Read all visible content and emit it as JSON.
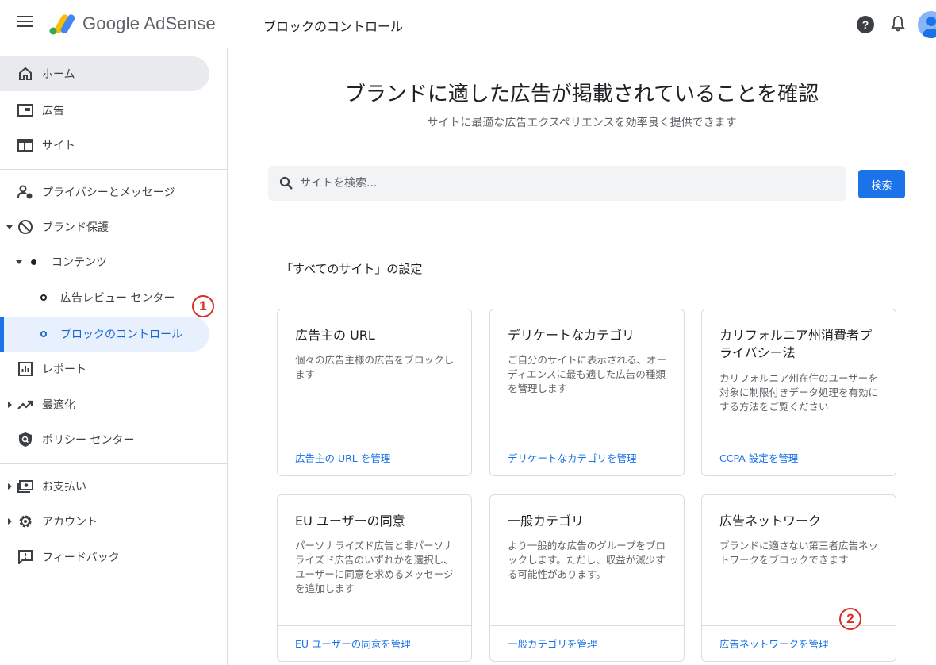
{
  "header": {
    "brand": "Google AdSense",
    "page_title": "ブロックのコントロール",
    "help_glyph": "?"
  },
  "sidebar": {
    "items": [
      {
        "label": "ホーム",
        "icon": "home-icon"
      },
      {
        "label": "広告",
        "icon": "ads-icon"
      },
      {
        "label": "サイト",
        "icon": "sites-icon"
      },
      {
        "label": "プライバシーとメッセージ",
        "icon": "privacy-icon"
      },
      {
        "label": "ブランド保護",
        "icon": "block-icon"
      },
      {
        "label": "コンテンツ",
        "icon": "dot-icon"
      },
      {
        "label": "広告レビュー センター",
        "icon": "ring-icon"
      },
      {
        "label": "ブロックのコントロール",
        "icon": "ring-icon"
      },
      {
        "label": "レポート",
        "icon": "report-icon"
      },
      {
        "label": "最適化",
        "icon": "trending-icon"
      },
      {
        "label": "ポリシー センター",
        "icon": "policy-shield-icon"
      },
      {
        "label": "お支払い",
        "icon": "payments-icon"
      },
      {
        "label": "アカウント",
        "icon": "settings-gear-icon"
      },
      {
        "label": "フィードバック",
        "icon": "feedback-icon"
      }
    ]
  },
  "annotations": {
    "one": "1",
    "two": "2"
  },
  "main": {
    "title": "ブランドに適した広告が掲載されていることを確認",
    "subtitle": "サイトに最適な広告エクスペリエンスを効率良く提供できます",
    "search": {
      "placeholder": "サイトを検索...",
      "button_label": "検索"
    },
    "section_heading": "「すべてのサイト」の設定",
    "cards": [
      {
        "title": "広告主の URL",
        "description": "個々の広告主様の広告をブロックします",
        "link": "広告主の URL を管理"
      },
      {
        "title": "デリケートなカテゴリ",
        "description": "ご自分のサイトに表示される、オーディエンスに最も適した広告の種類を管理します",
        "link": "デリケートなカテゴリを管理"
      },
      {
        "title": "カリフォルニア州消費者プライバシー法",
        "description": "カリフォルニア州在住のユーザーを対象に制限付きデータ処理を有効にする方法をご覧ください",
        "link": "CCPA 設定を管理"
      },
      {
        "title": "EU ユーザーの同意",
        "description": "パーソナライズド広告と非パーソナライズド広告のいずれかを選択し、ユーザーに同意を求めるメッセージを追加します",
        "link": "EU ユーザーの同意を管理"
      },
      {
        "title": "一般カテゴリ",
        "description": "より一般的な広告のグループをブロックします。ただし、収益が減少する可能性があります。",
        "link": "一般カテゴリを管理"
      },
      {
        "title": "広告ネットワーク",
        "description": "ブランドに適さない第三者広告ネットワークをブロックできます",
        "link": "広告ネットワークを管理"
      }
    ]
  },
  "colors": {
    "accent": "#1a73e8",
    "active_bg": "#e8f0fe",
    "annotation": "#d93025"
  }
}
